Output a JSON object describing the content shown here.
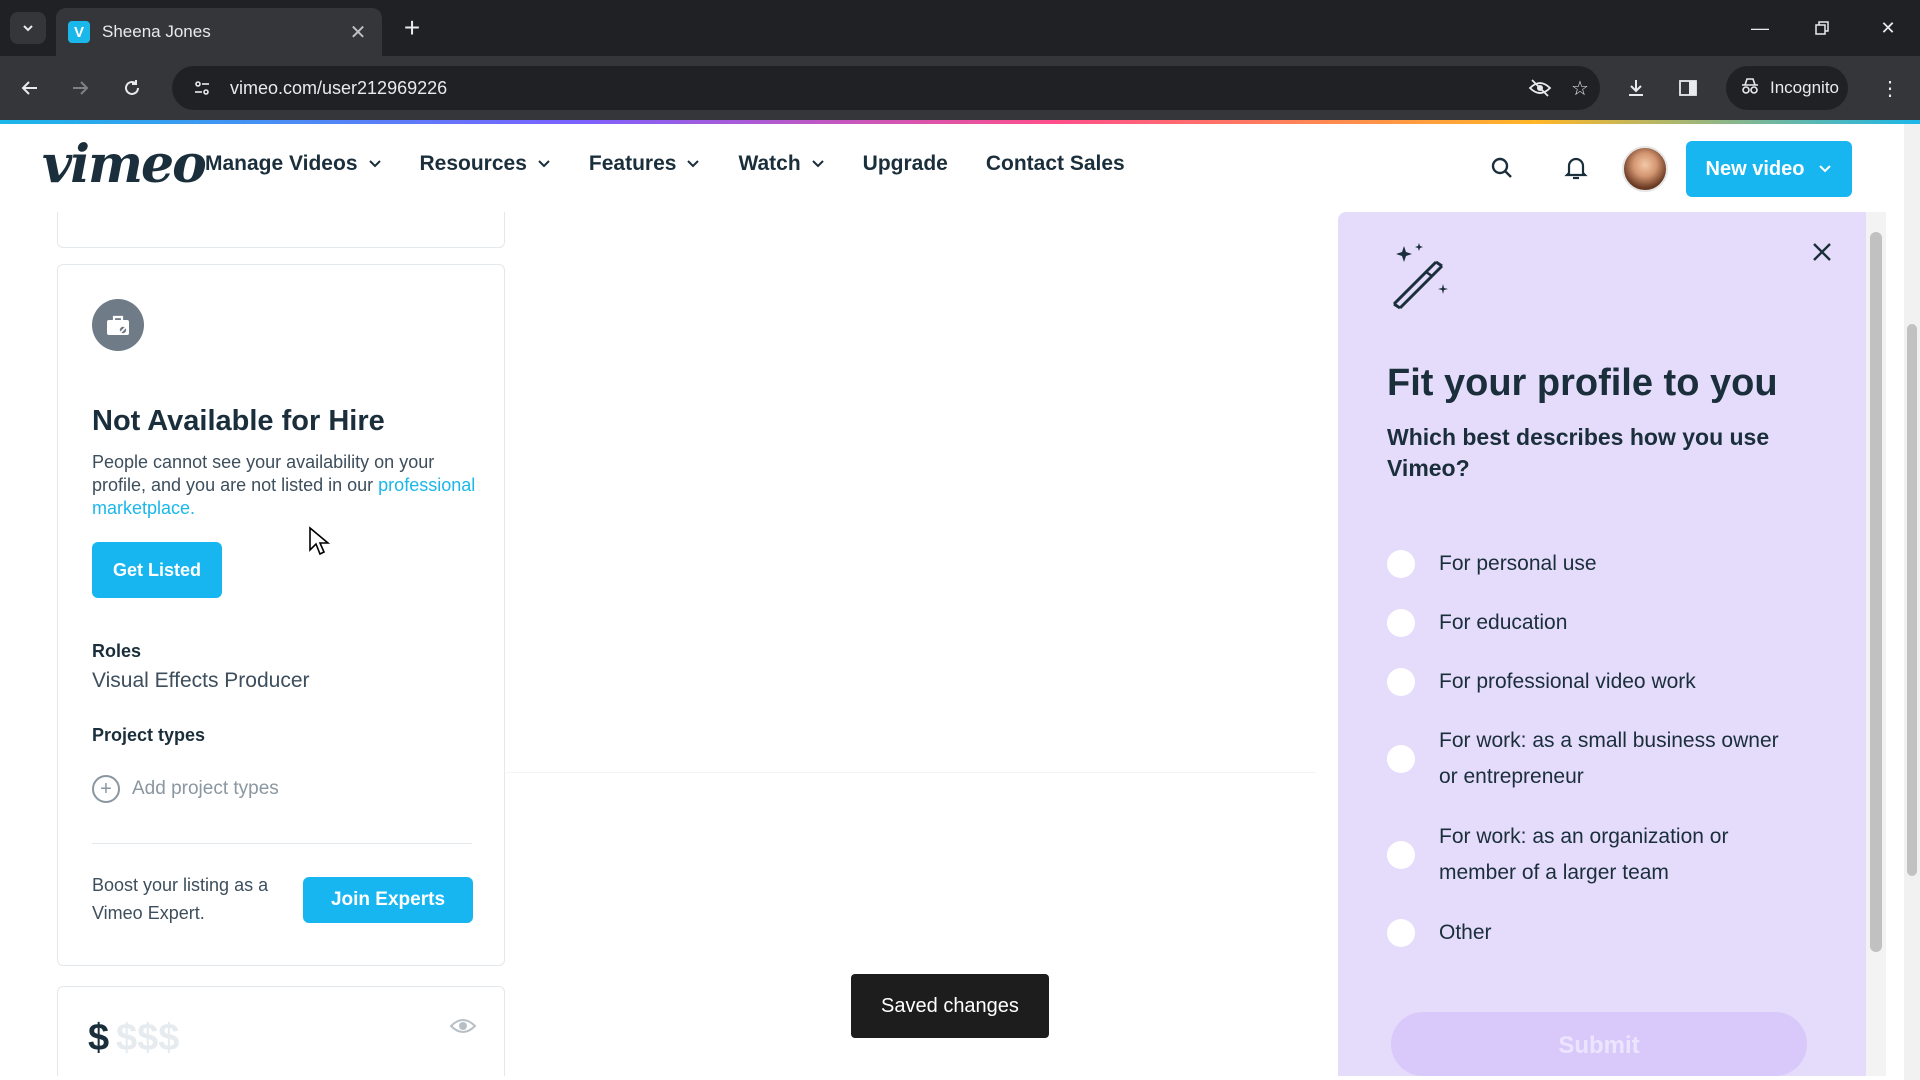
{
  "browser": {
    "tab_title": "Sheena Jones",
    "tab_favicon": "V",
    "url": "vimeo.com/user212969226",
    "incognito_label": "Incognito"
  },
  "header": {
    "logo": "vimeo",
    "nav": [
      {
        "label": "Manage Videos",
        "has_dropdown": true
      },
      {
        "label": "Resources",
        "has_dropdown": true
      },
      {
        "label": "Features",
        "has_dropdown": true
      },
      {
        "label": "Watch",
        "has_dropdown": true
      },
      {
        "label": "Upgrade",
        "has_dropdown": false
      },
      {
        "label": "Contact Sales",
        "has_dropdown": false
      }
    ],
    "new_video_label": "New video"
  },
  "hire_card": {
    "title": "Not Available for Hire",
    "desc_text": "People cannot see your availability on your profile, and you are not listed in our ",
    "desc_link": "professional marketplace",
    "desc_end": ".",
    "get_listed_label": "Get Listed",
    "roles_label": "Roles",
    "roles_value": "Visual Effects Producer",
    "project_types_label": "Project types",
    "add_project_types_label": "Add project types",
    "boost_text": "Boost your listing as a Vimeo Expert.",
    "join_label": "Join Experts"
  },
  "rate_card": {
    "currency": "$",
    "placeholder": "$$$"
  },
  "toast": "Saved changes",
  "panel": {
    "title": "Fit your profile to you",
    "question": "Which best describes how you use Vimeo?",
    "options": [
      "For personal use",
      "For education",
      "For professional video work",
      "For work: as a small business owner or entrepreneur",
      "For work: as an organization or member of a larger team",
      "Other"
    ],
    "submit_label": "Submit"
  },
  "colors": {
    "accent": "#17b6f1",
    "panel_bg": "#e5dcfb",
    "text": "#1a2e3b"
  }
}
